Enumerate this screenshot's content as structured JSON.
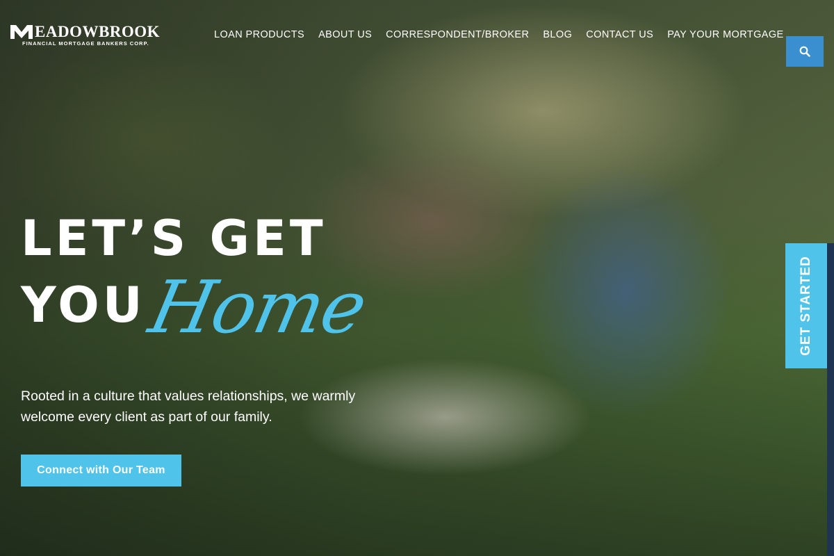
{
  "brand": {
    "name": "EADOWBROOK",
    "subtitle": "FINANCIAL MORTGAGE BANKERS CORP.",
    "logo_icon": "meadowbrook-m-icon"
  },
  "nav": {
    "items": [
      {
        "label": "LOAN PRODUCTS"
      },
      {
        "label": "ABOUT US"
      },
      {
        "label": "CORRESPONDENT/BROKER"
      },
      {
        "label": "BLOG"
      },
      {
        "label": "CONTACT US"
      },
      {
        "label": "PAY YOUR MORTGAGE"
      }
    ],
    "search_icon": "search-icon"
  },
  "hero": {
    "headline_line1": "LET’S GET",
    "headline_line2": "YOU",
    "script_word": "Home",
    "tagline": "Rooted in a culture that values relationships, we warmly welcome every client as part of our family.",
    "cta_label": "Connect with Our Team"
  },
  "side_tab": {
    "label": "GET STARTED"
  },
  "colors": {
    "accent": "#4fc3ea",
    "search_button": "#3a8fd0",
    "text": "#ffffff",
    "edge_bar": "#1e3450"
  }
}
